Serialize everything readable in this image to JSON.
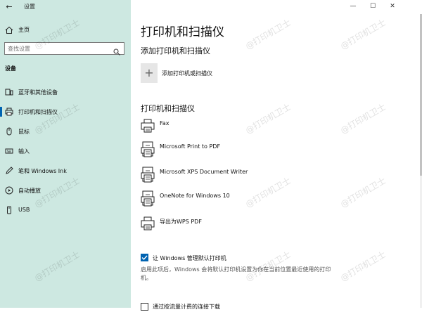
{
  "window": {
    "title": "设置",
    "minimize": "—",
    "maximize": "☐",
    "close": "✕"
  },
  "sidebar": {
    "back_icon": "back-arrow-icon",
    "home": {
      "label": "主页",
      "icon": "home-icon"
    },
    "search": {
      "placeholder": "查找设置",
      "icon": "search-icon"
    },
    "section": "设备",
    "items": [
      {
        "label": "蓝牙和其他设备",
        "icon": "bluetooth-devices-icon",
        "active": false
      },
      {
        "label": "打印机和扫描仪",
        "icon": "printer-icon",
        "active": true
      },
      {
        "label": "鼠标",
        "icon": "mouse-icon",
        "active": false
      },
      {
        "label": "输入",
        "icon": "keyboard-icon",
        "active": false
      },
      {
        "label": "笔和 Windows Ink",
        "icon": "pen-icon",
        "active": false
      },
      {
        "label": "自动播放",
        "icon": "autoplay-icon",
        "active": false
      },
      {
        "label": "USB",
        "icon": "usb-icon",
        "active": false
      }
    ]
  },
  "main": {
    "title": "打印机和扫描仪",
    "add_section": "添加打印机和扫描仪",
    "add_button": "添加打印机或扫描仪",
    "list_section": "打印机和扫描仪",
    "printers": [
      {
        "name": "Fax",
        "icon": "printer-icon"
      },
      {
        "name": "Microsoft Print to PDF",
        "icon": "printer-pdf-icon"
      },
      {
        "name": "Microsoft XPS Document Writer",
        "icon": "printer-xps-icon"
      },
      {
        "name": "OneNote for Windows 10",
        "icon": "printer-onenote-icon"
      },
      {
        "name": "导出为WPS PDF",
        "icon": "printer-icon"
      }
    ],
    "default_checkbox": {
      "label": "让 Windows 管理默认打印机",
      "checked": true
    },
    "description": "启用此项后，Windows 会将默认打印机设置为你在当前位置最近使用的打印机。",
    "metered_checkbox": {
      "label": "通过按流量计费的连接下载",
      "checked": false
    }
  },
  "watermark": "@打印机卫士",
  "colors": {
    "sidebar_bg": "#cde8e1",
    "accent": "#0063b1"
  }
}
